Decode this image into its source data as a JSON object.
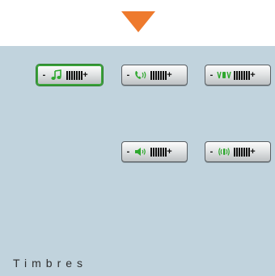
{
  "header": {
    "arrow_icon": "triangle-down-icon",
    "arrow_color": "#ee7a2d"
  },
  "panel": {
    "background": "#c1d3dd",
    "selected_color": "#3aa23a"
  },
  "controls": [
    {
      "icon": "music-note-icon",
      "minus": "-",
      "plus": "+",
      "level_bars": 7,
      "selected": true
    },
    {
      "icon": "phone-ring-icon",
      "minus": "-",
      "plus": "+",
      "level_bars": 7,
      "selected": false
    },
    {
      "icon": "vibrate-icon",
      "minus": "-",
      "plus": "+",
      "level_bars": 7,
      "selected": false
    },
    {
      "icon": "speaker-icon",
      "minus": "-",
      "plus": "+",
      "level_bars": 7,
      "selected": false
    },
    {
      "icon": "sound-waves-icon",
      "minus": "-",
      "plus": "+",
      "level_bars": 7,
      "selected": false
    }
  ],
  "footer": {
    "label": "Timbres"
  }
}
